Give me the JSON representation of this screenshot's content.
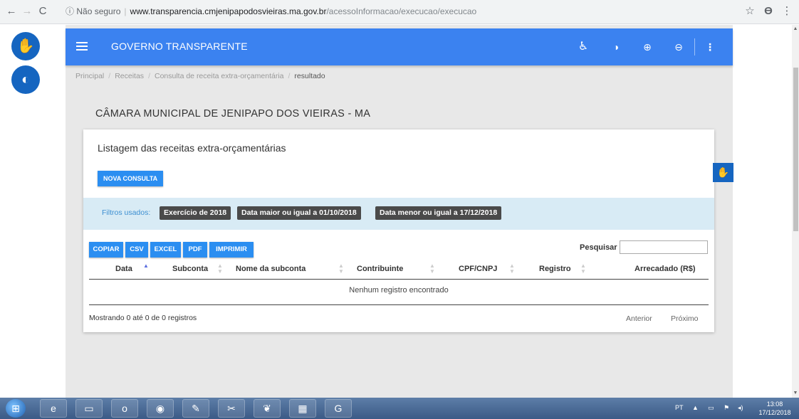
{
  "browser": {
    "security_label": "Não seguro",
    "url_host": "www.transparencia.cmjenipapodosvieiras.ma.gov.br",
    "url_path": "/acessoInformacao/execucao/execucao"
  },
  "header": {
    "title": "GOVERNO TRANSPARENTE"
  },
  "breadcrumb": {
    "items": [
      "Principal",
      "Receitas",
      "Consulta de receita extra-orçamentária"
    ],
    "current": "resultado"
  },
  "org_title": "CÂMARA MUNICIPAL DE JENIPAPO DOS VIEIRAS - MA",
  "card": {
    "title": "Listagem das receitas extra-orçamentárias",
    "new_query_label": "NOVA CONSULTA"
  },
  "filters": {
    "label": "Filtros usados:",
    "chips": [
      "Exercício de 2018",
      "Data maior ou igual a 01/10/2018",
      "Data menor ou igual a 17/12/2018"
    ]
  },
  "export_buttons": [
    "COPIAR",
    "CSV",
    "EXCEL",
    "PDF",
    "IMPRIMIR"
  ],
  "search": {
    "label": "Pesquisar",
    "value": ""
  },
  "table": {
    "columns": [
      "Data",
      "Subconta",
      "Nome da subconta",
      "Contribuinte",
      "CPF/CNPJ",
      "Registro",
      "Arrecadado (R$)"
    ],
    "empty_message": "Nenhum registro encontrado"
  },
  "footer": {
    "info": "Mostrando 0 até 0 de 0 registros",
    "prev_label": "Anterior",
    "next_label": "Próximo"
  },
  "taskbar": {
    "language": "PT",
    "time": "13:08",
    "date": "17/12/2018"
  },
  "colors": {
    "accent": "#3b82f0",
    "button": "#2b8ef1",
    "float_button": "#1565c0",
    "filter_bg": "#d8ebf5",
    "chip_bg": "#4a4a4a"
  }
}
